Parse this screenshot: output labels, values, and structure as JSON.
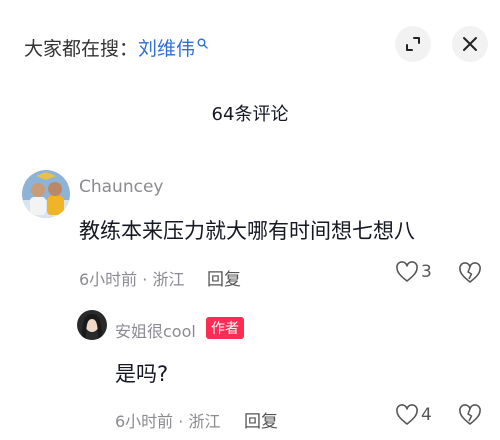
{
  "header": {
    "search_prefix": "大家都在搜：",
    "search_keyword": "刘维伟"
  },
  "comments_title": "64条评论",
  "comments": [
    {
      "username": "Chauncey",
      "content": "教练本来压力就大哪有时间想七想八",
      "meta": "6小时前 · 浙江",
      "reply_label": "回复",
      "likes": "3"
    },
    {
      "username": "安姐很cool",
      "badge": "作者",
      "content": "是吗?",
      "meta": "6小时前 · 浙江",
      "reply_label": "回复",
      "likes": "4"
    }
  ],
  "colors": {
    "keyword": "#2f6fd6",
    "author_badge": "#fe2c55"
  }
}
